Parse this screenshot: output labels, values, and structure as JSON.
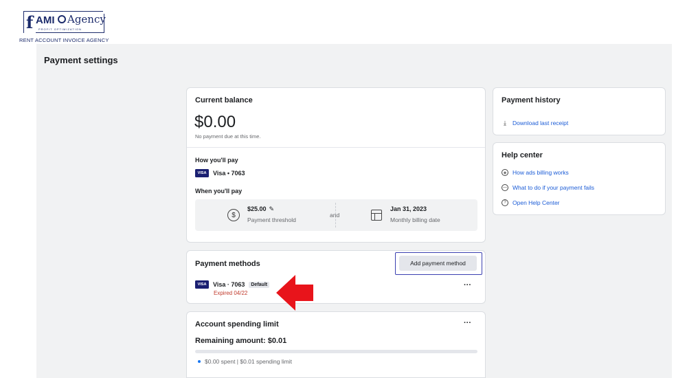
{
  "logo": {
    "f": "f",
    "ami": "AMI",
    "agency": "Agency",
    "tagline": "PROFIT OPTIMIZATION",
    "subtitle": "RENT ACCOUNT INVOICE AGENCY"
  },
  "page": {
    "title": "Payment settings"
  },
  "balance": {
    "title": "Current balance",
    "amount": "$0.00",
    "note": "No payment due at this time.",
    "how_label": "How you'll pay",
    "card_brand": "VISA",
    "card_text": "Visa • 7063",
    "when_label": "When you'll pay",
    "threshold_value": "$25.00",
    "threshold_label": "Payment threshold",
    "and_text": "and",
    "billing_date": "Jan 31, 2023",
    "billing_label": "Monthly billing date"
  },
  "methods": {
    "title": "Payment methods",
    "add_button": "Add payment method",
    "card_brand": "VISA",
    "card_text": "Visa · 7063",
    "default_tag": "Default",
    "expired": "Expired 04/22",
    "more": "···"
  },
  "limit": {
    "title": "Account spending limit",
    "more": "···",
    "remaining": "Remaining amount: $0.01",
    "legend": "$0.00 spent | $0.01 spending limit",
    "spent_fraction": 0
  },
  "history": {
    "title": "Payment history",
    "download": "Download last receipt"
  },
  "help": {
    "title": "Help center",
    "links": [
      "How ads billing works",
      "What to do if your payment fails",
      "Open Help Center"
    ]
  },
  "colors": {
    "link": "#1a5bd6",
    "expired": "#c0392b",
    "highlight_border": "#3a3fb0",
    "arrow": "#e8141b",
    "progress": "#1877f2"
  },
  "icons": {
    "download": "download-icon",
    "billing": "cubes-icon",
    "fail": "minus-circle-icon",
    "help": "question-circle-icon",
    "threshold": "dollar-circle-icon",
    "calendar": "calendar-icon"
  }
}
